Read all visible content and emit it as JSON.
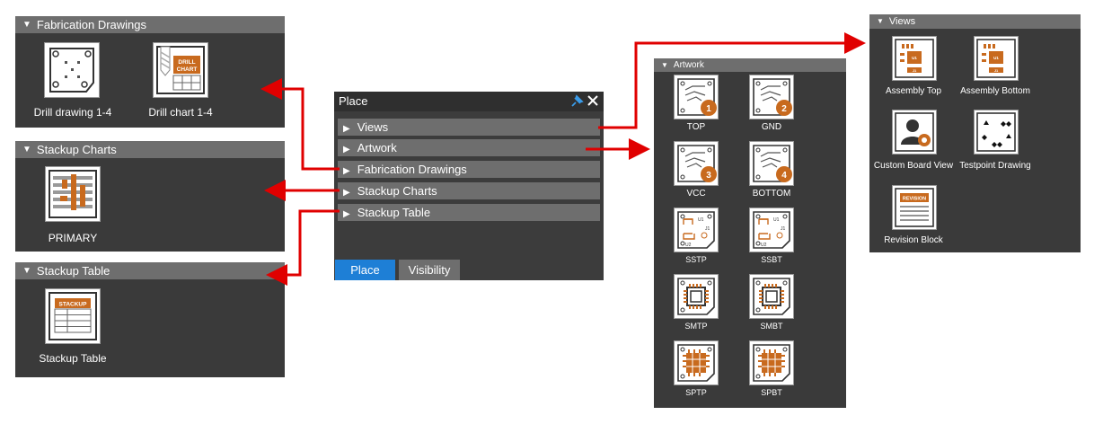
{
  "place_panel": {
    "title": "Place",
    "rows": [
      "Views",
      "Artwork",
      "Fabrication Drawings",
      "Stackup Charts",
      "Stackup Table"
    ],
    "tabs": [
      "Place",
      "Visibility"
    ],
    "active_tab_color": "#1e7fd6"
  },
  "fabrication": {
    "header": "Fabrication Drawings",
    "items": [
      "Drill drawing 1-4",
      "Drill chart 1-4"
    ],
    "drill_chart_text": [
      "DRILL",
      "CHART"
    ]
  },
  "stackup_charts": {
    "header": "Stackup Charts",
    "items": [
      "PRIMARY"
    ]
  },
  "stackup_table": {
    "header": "Stackup Table",
    "items": [
      "Stackup Table"
    ],
    "tile_text": "STACKUP"
  },
  "artwork": {
    "header": "Artwork",
    "items": [
      "TOP",
      "GND",
      "VCC",
      "BOTTOM",
      "SSTP",
      "SSBT",
      "SMTP",
      "SMBT",
      "SPTP",
      "SPBT"
    ],
    "layer_numbers": [
      "1",
      "2",
      "3",
      "4"
    ],
    "ss_marks": [
      "U1",
      "J1",
      "U2"
    ]
  },
  "views": {
    "header": "Views",
    "items": [
      "Assembly Top",
      "Assembly Bottom",
      "Custom Board View",
      "Testpoint Drawing",
      "Revision Block"
    ],
    "assembly_marks": [
      "U1",
      "J1"
    ],
    "revision_text": "REVISION"
  },
  "colors": {
    "accent_orange": "#c86a1e",
    "arrow_red": "#e00000",
    "panel_bg": "#3a3a3a",
    "header_bg": "#6e6e6e"
  }
}
